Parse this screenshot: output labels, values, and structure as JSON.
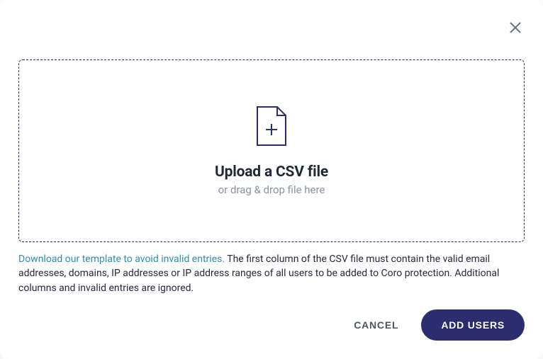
{
  "modal": {
    "dropzone": {
      "title": "Upload a CSV file",
      "subtitle": "or drag & drop file here"
    },
    "helper": {
      "link": "Download our template to avoid invalid entries.",
      "text": " The first column of the CSV file must contain the valid email addresses, domains, IP addresses or IP address ranges of all users to be added to Coro protection. Additional columns and invalid entries are ignored."
    },
    "actions": {
      "cancel": "CANCEL",
      "submit": "ADD USERS"
    }
  }
}
